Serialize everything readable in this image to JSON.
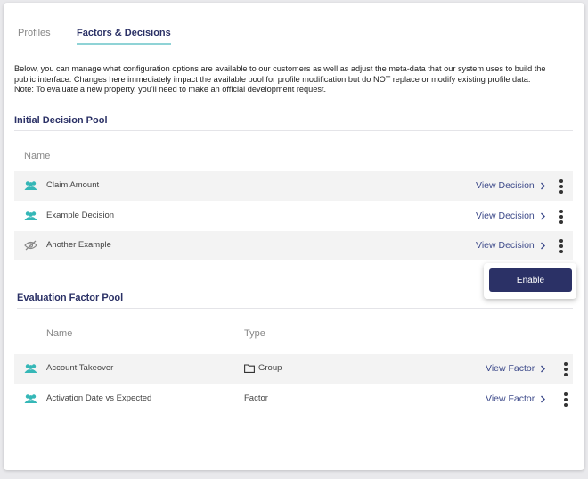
{
  "tabs": [
    {
      "label": "Profiles"
    },
    {
      "label": "Factors & Decisions"
    }
  ],
  "description": {
    "line1": "Below, you can manage what configuration options are available to our customers as well as adjust the meta-data that our system uses to build the",
    "line2": "public interface. Changes here immediately impact the available pool for profile modification but do NOT replace or modify existing profile data.",
    "line3": "Note: To evaluate a new property, you'll need to make an official development request."
  },
  "decision_pool": {
    "title": "Initial Decision Pool",
    "name_header": "Name",
    "rows": [
      {
        "icon": "people-icon",
        "name": "Claim Amount",
        "action": "View Decision"
      },
      {
        "icon": "people-icon",
        "name": "Example Decision",
        "action": "View Decision"
      },
      {
        "icon": "eye-off-icon",
        "name": "Another Example",
        "action": "View Decision"
      }
    ]
  },
  "popover": {
    "button_label": "Enable"
  },
  "factor_pool": {
    "title": "Evaluation Factor Pool",
    "name_header": "Name",
    "type_header": "Type",
    "rows": [
      {
        "icon": "people-icon",
        "name": "Account Takeover",
        "type": "Group",
        "type_icon": "folder-icon",
        "action": "View Factor"
      },
      {
        "icon": "people-icon",
        "name": "Activation Date vs Expected",
        "type": "Factor",
        "action": "View Factor"
      }
    ]
  },
  "colors": {
    "accent": "#2b3166",
    "tab_underline": "#8fd3d6",
    "icon_teal": "#35b7b7",
    "link": "#3d4a8a",
    "row_shade": "#f3f3f3"
  }
}
